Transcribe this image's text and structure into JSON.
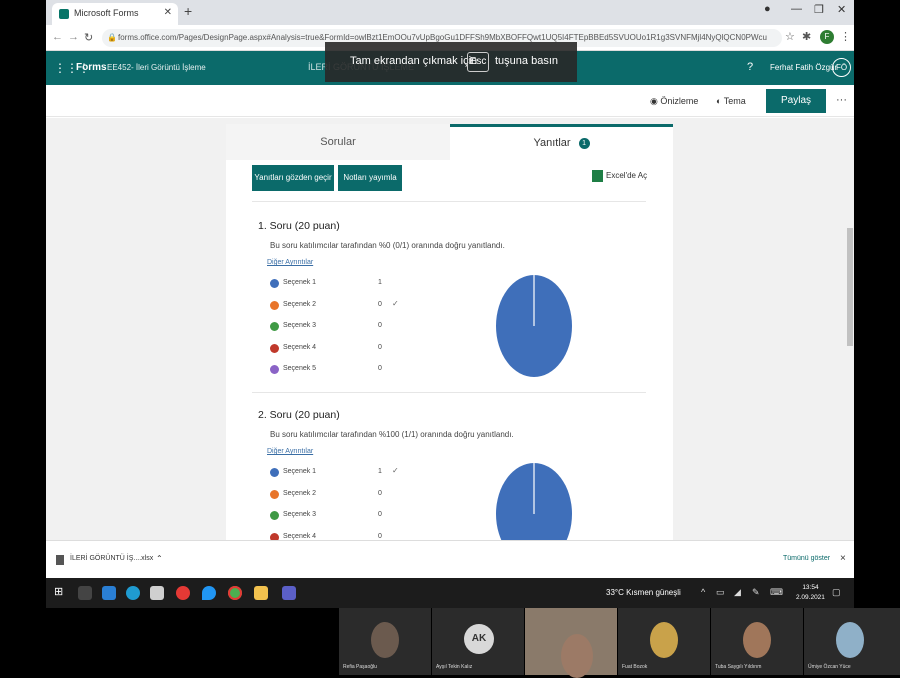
{
  "browser": {
    "tab_title": "Microsoft Forms",
    "url": "forms.office.com/Pages/DesignPage.aspx#Analysis=true&FormId=owlBzt1EmOOu7vUpBgoGu1DFFSh9MbXBOFFQwt1UQ5I4FTEpBBEd5SVUOUo1R1g3SVNFMjl4NyQlQCN0PWcu"
  },
  "esc_overlay": {
    "text_before": "Tam ekrandan çıkmak için",
    "key": "Esc",
    "text_after": "tuşuna basın"
  },
  "forms_header": {
    "brand": "Forms",
    "form_name": "EE452- İleri Görüntü İşleme",
    "center_title": "İLERİ GÖRÜNTÜ İŞLEME",
    "help": "?",
    "user_name": "Ferhat Fatih Özgür",
    "user_initials": "FÖ"
  },
  "commands": {
    "preview": "Önizleme",
    "theme": "Tema",
    "share": "Paylaş",
    "more": "···"
  },
  "tabs": {
    "questions": "Sorular",
    "responses": "Yanıtlar",
    "response_count": "1"
  },
  "actions": {
    "review": "Yanıtları gözden geçir",
    "post_scores": "Notları yayımla",
    "excel": "Excel'de Aç"
  },
  "questions": [
    {
      "title": "1.  Soru (20 puan)",
      "description": "Bu soru katılımcılar tarafından %0 (0/1) oranında doğru yanıtlandı.",
      "details_link": "Diğer Ayrıntılar",
      "options": [
        {
          "label": "Seçenek 1",
          "count": "1",
          "color": "#3f6fba",
          "correct": false
        },
        {
          "label": "Seçenek 2",
          "count": "0",
          "color": "#e8752b",
          "correct": true
        },
        {
          "label": "Seçenek 3",
          "count": "0",
          "color": "#3f9a45",
          "correct": false
        },
        {
          "label": "Seçenek 4",
          "count": "0",
          "color": "#c0392b",
          "correct": false
        },
        {
          "label": "Seçenek 5",
          "count": "0",
          "color": "#8a63c6",
          "correct": false
        }
      ]
    },
    {
      "title": "2.  Soru (20 puan)",
      "description": "Bu soru katılımcılar tarafından %100 (1/1) oranında doğru yanıtlandı.",
      "details_link": "Diğer Ayrıntılar",
      "options": [
        {
          "label": "Seçenek 1",
          "count": "1",
          "color": "#3f6fba",
          "correct": true
        },
        {
          "label": "Seçenek 2",
          "count": "0",
          "color": "#e8752b",
          "correct": false
        },
        {
          "label": "Seçenek 3",
          "count": "0",
          "color": "#3f9a45",
          "correct": false
        },
        {
          "label": "Seçenek 4",
          "count": "0",
          "color": "#c0392b",
          "correct": false
        }
      ]
    }
  ],
  "check_mark": "✓",
  "download_bar": {
    "file_name": "İLERİ GÖRÜNTÜ İŞ....xlsx",
    "show_all": "Tümünü göster",
    "close": "×"
  },
  "taskbar": {
    "weather": "33°C  Kısmen güneşli",
    "time": "13:54",
    "date": "2.09.2021"
  },
  "participants": [
    {
      "name": "Refia Paşaoğlu",
      "initials": ""
    },
    {
      "name": "Ayşıl Tekin Kalız",
      "initials": "AK"
    },
    {
      "name": "",
      "initials": ""
    },
    {
      "name": "Fuat Bozok",
      "initials": ""
    },
    {
      "name": "Tuba Saygılı Yıldırım",
      "initials": ""
    },
    {
      "name": "Ümiye Özcan Yüce",
      "initials": ""
    }
  ]
}
